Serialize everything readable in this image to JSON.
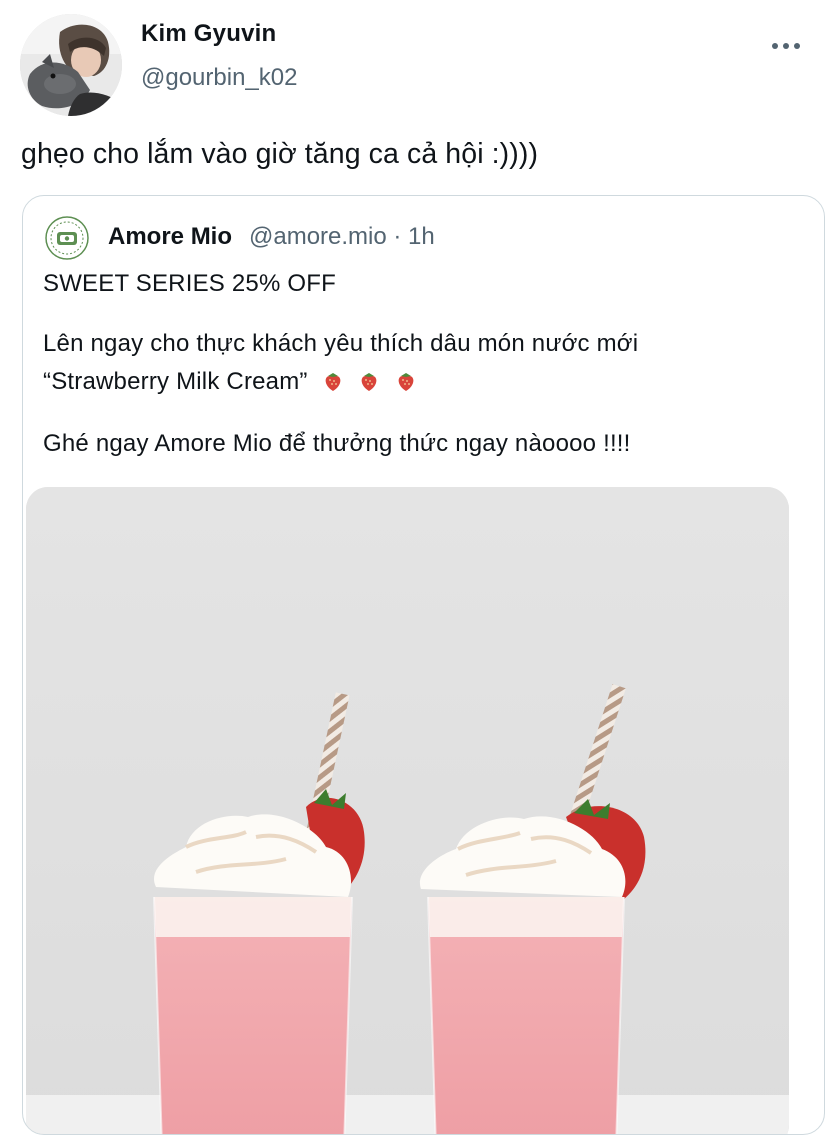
{
  "author": {
    "display_name": "Kim Gyuvin",
    "handle": "@gourbin_k02"
  },
  "tweet": {
    "text": "ghẹo cho lắm vào giờ tăng ca cả hội :))))"
  },
  "quoted": {
    "display_name": "Amore Mio",
    "meta": "@amore.mio · 1h",
    "line1": "SWEET SERIES 25% OFF",
    "line2": "Lên ngay cho thực khách yêu thích dâu món nước mới",
    "line3": "“Strawberry Milk Cream”",
    "line4": "Ghé ngay Amore Mio để thưởng thức ngay nàoooo !!!!"
  },
  "icons": {
    "more": "more-icon",
    "strawberry": "strawberry-emoji-icon"
  },
  "colors": {
    "text": "#0f1419",
    "muted": "#536471",
    "border": "#cfd9de",
    "drink": "#f3a9ad",
    "cream": "#fbf8f3"
  }
}
